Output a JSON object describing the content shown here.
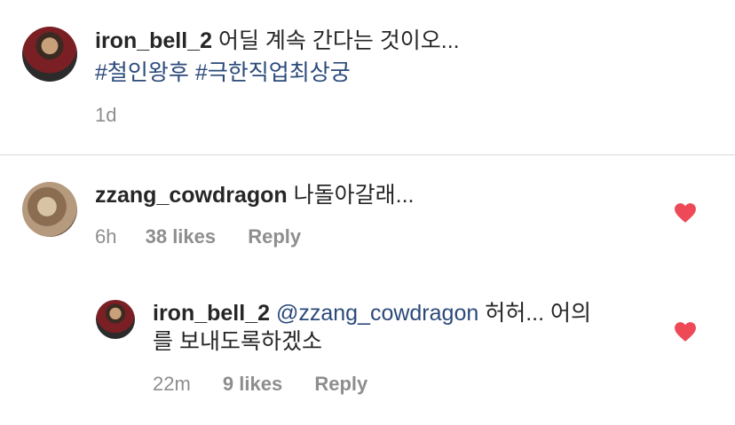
{
  "post": {
    "username": "iron_bell_2",
    "caption": "어딜 계속 간다는 것이오...",
    "hashtags": "#철인왕후 #극한직업최상궁",
    "time": "1d"
  },
  "comment": {
    "username": "zzang_cowdragon",
    "text": "나돌아갈래...",
    "time": "6h",
    "likes": "38 likes",
    "reply_label": "Reply"
  },
  "reply": {
    "username": "iron_bell_2",
    "mention": "@zzang_cowdragon",
    "text_line1": "허허... 어의",
    "text_line2": "를 보내도록하겠소",
    "time": "22m",
    "likes": "9 likes",
    "reply_label": "Reply"
  },
  "colors": {
    "heart": "#ed4956",
    "hashtag": "#2b4a7a",
    "meta": "#8e8e8e"
  },
  "icons": {
    "like": "heart-icon"
  }
}
